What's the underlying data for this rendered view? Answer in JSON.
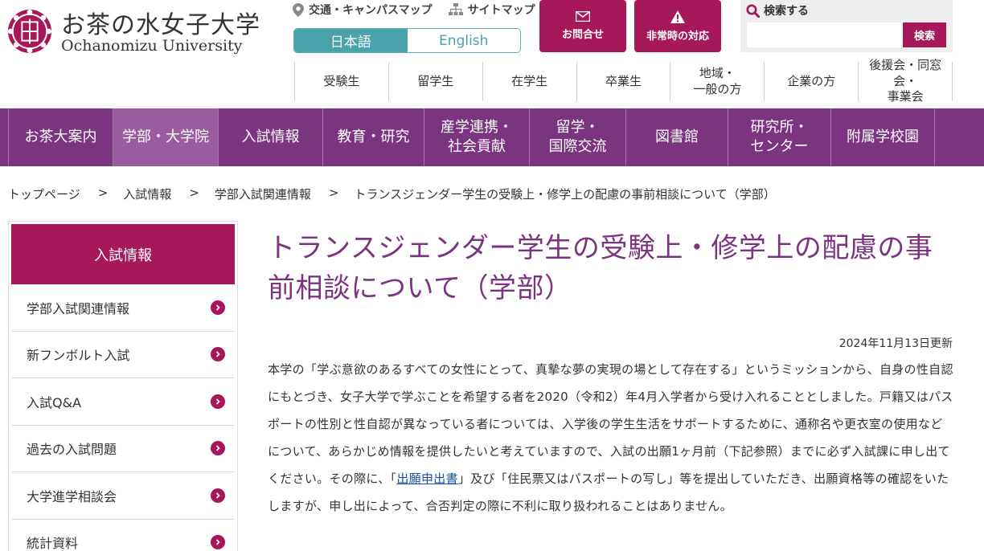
{
  "header": {
    "logo_jp": "お茶の水女子大学",
    "logo_en": "Ochanomizu University",
    "crest_icon": "university-crest-icon",
    "utility_links": [
      {
        "label": "交通・キャンパスマップ",
        "icon": "map-pin-icon"
      },
      {
        "label": "サイトマップ",
        "icon": "sitemap-icon"
      }
    ],
    "language": {
      "japanese": "日本語",
      "english": "English",
      "active": "japanese"
    },
    "contact_label": "お問合せ",
    "emergency_label": "非常時の対応",
    "search": {
      "label": "検索する",
      "placeholder": "",
      "value": "",
      "button_label": "検索"
    },
    "audience_nav": [
      "受験生",
      "留学生",
      "在学生",
      "卒業生",
      "地域・\n一般の方",
      "企業の方",
      "後援会・同窓会・\n事業会"
    ]
  },
  "global_nav": [
    {
      "label": "お茶大案内",
      "active": false
    },
    {
      "label": "学部・大学院",
      "active": true
    },
    {
      "label": "入試情報",
      "active": false
    },
    {
      "label": "教育・研究",
      "active": false
    },
    {
      "label": "産学連携・\n社会貢献",
      "active": false
    },
    {
      "label": "留学・\n国際交流",
      "active": false
    },
    {
      "label": "図書館",
      "active": false
    },
    {
      "label": "研究所・\nセンター",
      "active": false
    },
    {
      "label": "附属学校園",
      "active": false
    }
  ],
  "breadcrumb": {
    "separator": ">",
    "items": [
      "トップページ",
      "入試情報",
      "学部入試関連情報",
      "トランスジェンダー学生の受験上・修学上の配慮の事前相談について（学部）"
    ]
  },
  "sidebar": {
    "title": "入試情報",
    "items": [
      "学部入試関連情報",
      "新フンボルト入試",
      "入試Q&A",
      "過去の入試問題",
      "大学進学相談会",
      "統計資料"
    ]
  },
  "main": {
    "title": "トランスジェンダー学生の受験上・修学上の配慮の事前相談について（学部）",
    "updated": "2024年11月13日更新",
    "body_before_link": "本学の「学ぶ意欲のあるすべての女性にとって、真摯な夢の実現の場として存在する」というミッションから、自身の性自認にもとづき、女子大学で学ぶことを希望する者を2020（令和2）年4月入学者から受け入れることとしました。戸籍又はパスポートの性別と性自認が異なっている者については、入学後の学生生活をサポートするために、通称名や更衣室の使用などについて、あらかじめ情報を提供したいと考えていますので、入試の出願1ヶ月前（下記参照）までに必ず入試課に申し出てください。その際に、「",
    "body_link": "出願申出書",
    "body_after_link": "」及び「住民票又はパスポートの写し」等を提出していただき、出願資格等の確認をいたしますが、申し出によって、合否判定の際に不利に取り扱われることはありません。"
  },
  "colors": {
    "brand_magenta": "#a6185a",
    "nav_purple": "#7b3580",
    "title_purple": "#7b3580",
    "teal": "#4aa3ab",
    "link_blue": "#1a4fa5"
  }
}
